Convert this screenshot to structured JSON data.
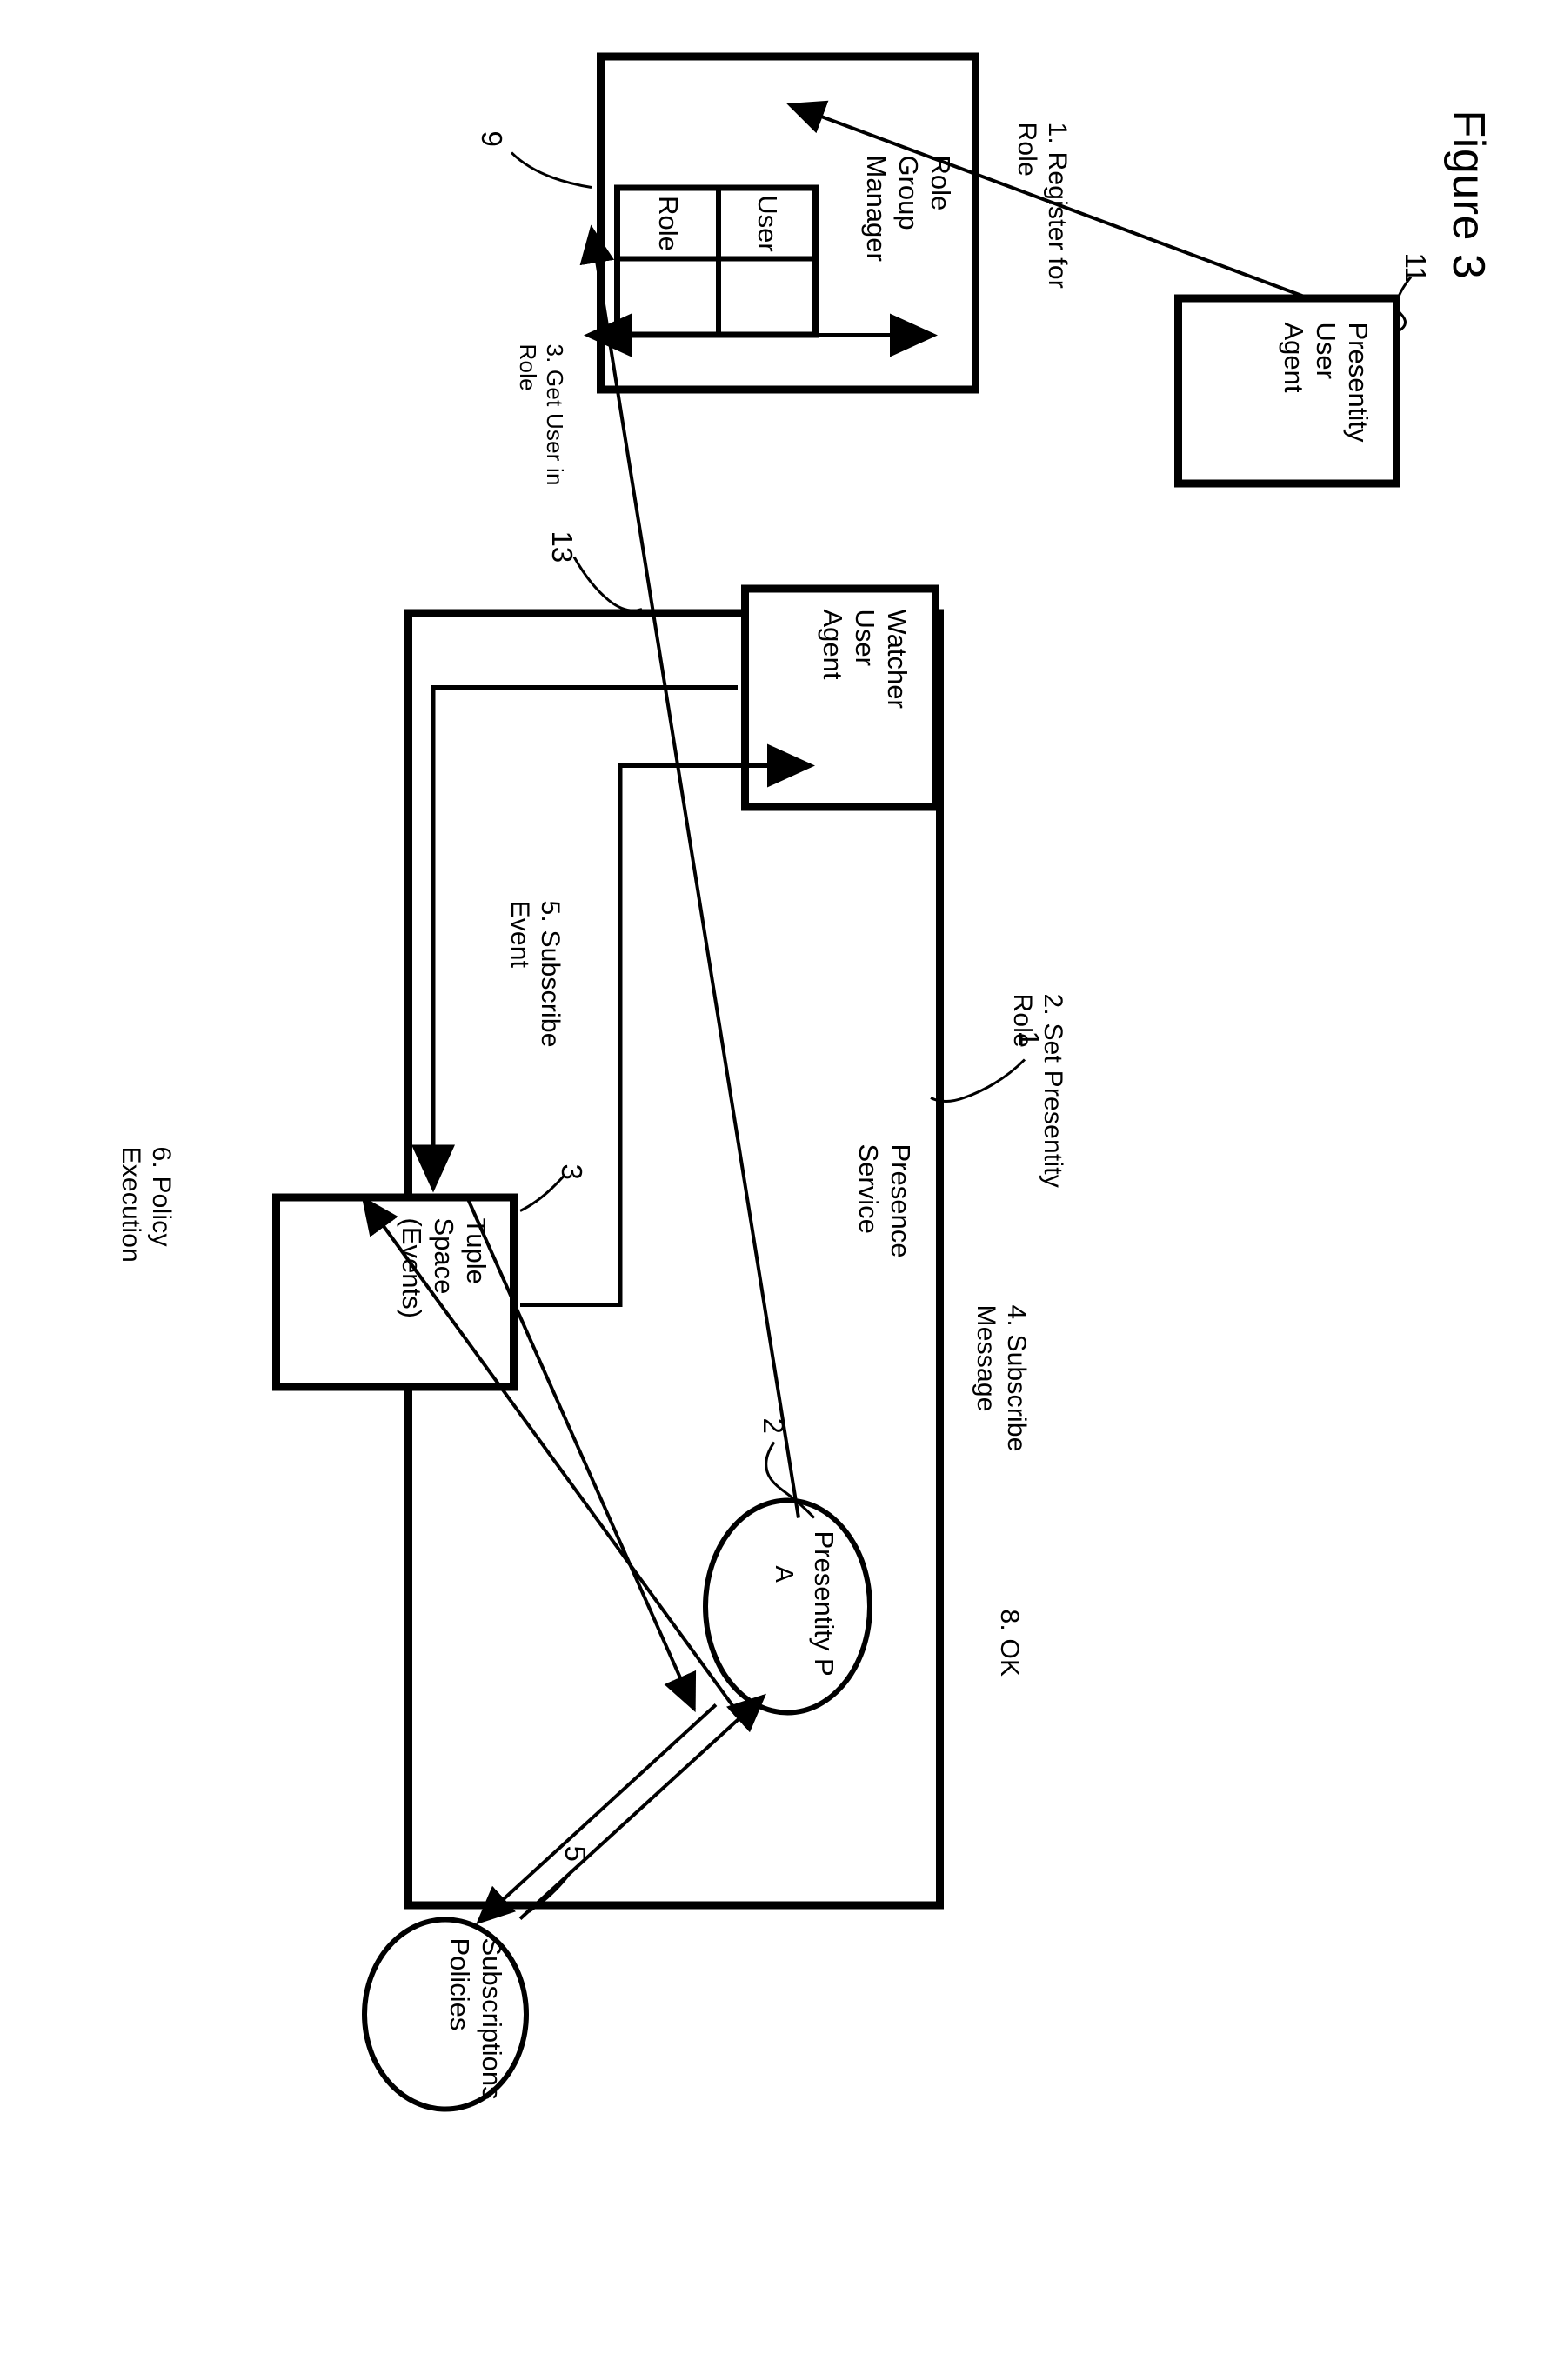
{
  "figure": {
    "title": "Figure 3"
  },
  "nodes": {
    "role_group_manager": {
      "label": "Role\nGroup\nManager",
      "ref": "9",
      "table": {
        "headers": [
          "User",
          "Role"
        ],
        "rows": [
          [
            "",
            ""
          ]
        ]
      }
    },
    "presentity_user_agent": {
      "label": "Presentity\nUser\nAgent",
      "ref": "11"
    },
    "watcher_user_agent": {
      "label": "Watcher\nUser\nAgent",
      "ref": "13"
    },
    "presence_service": {
      "label": "Presence\nService",
      "ref": "1"
    },
    "tuple_space": {
      "label": "Tuple\nSpace\n(Events)",
      "ref": "3"
    },
    "presentity": {
      "label": "Presentity P",
      "sublabel": "A",
      "ref": "2"
    },
    "subscriptions_policies": {
      "label": "Subscriptions\nPolicies",
      "ref": "5"
    }
  },
  "flows": [
    {
      "id": "f1",
      "label": "1. Register for\nRole"
    },
    {
      "id": "f2",
      "label": "2. Set Presentity\nRole"
    },
    {
      "id": "f3",
      "label": "3. Get User in\nRole"
    },
    {
      "id": "f4",
      "label": "4. Subscribe\nMessage"
    },
    {
      "id": "f5",
      "label": "5. Subscribe\nEvent"
    },
    {
      "id": "f6",
      "label": "6. Policy\nExecution"
    },
    {
      "id": "f8",
      "label": "8. OK"
    }
  ],
  "colors": {
    "ink": "#000000",
    "paper": "#ffffff"
  }
}
